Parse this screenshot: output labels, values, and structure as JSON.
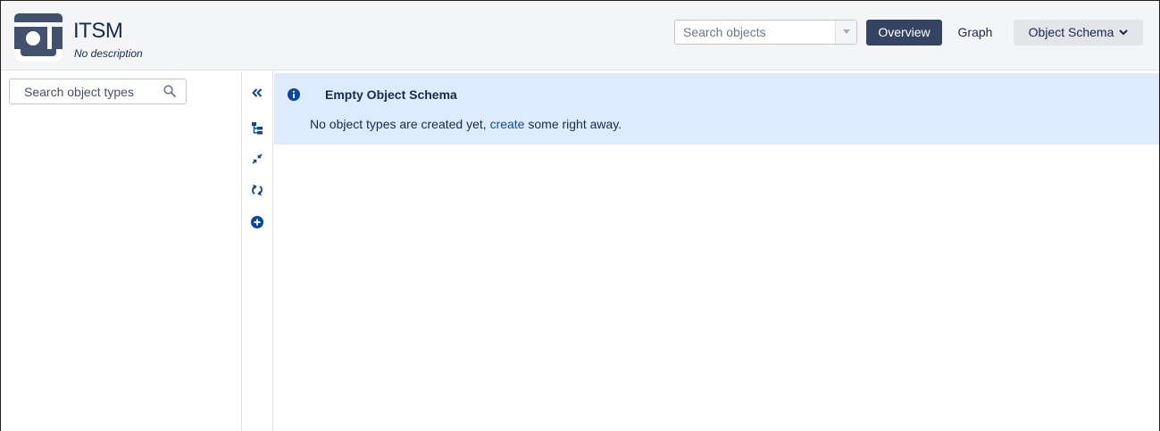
{
  "header": {
    "title": "ITSM",
    "description": "No description",
    "search_placeholder": "Search objects",
    "buttons": {
      "overview": "Overview",
      "graph": "Graph",
      "object_schema": "Object Schema"
    }
  },
  "sidebar": {
    "search_placeholder": "Search object types"
  },
  "tools": [
    "collapse-icon",
    "hierarchy-icon",
    "compress-icon",
    "refresh-icon",
    "add-circle-icon"
  ],
  "message": {
    "title": "Empty Object Schema",
    "body_prefix": "No object types are created yet, ",
    "link": "create",
    "body_suffix": " some right away."
  },
  "colors": {
    "accent": "#344563",
    "link": "#0052cc",
    "info_bg": "#deebff",
    "icon_blue": "#0747a6"
  }
}
